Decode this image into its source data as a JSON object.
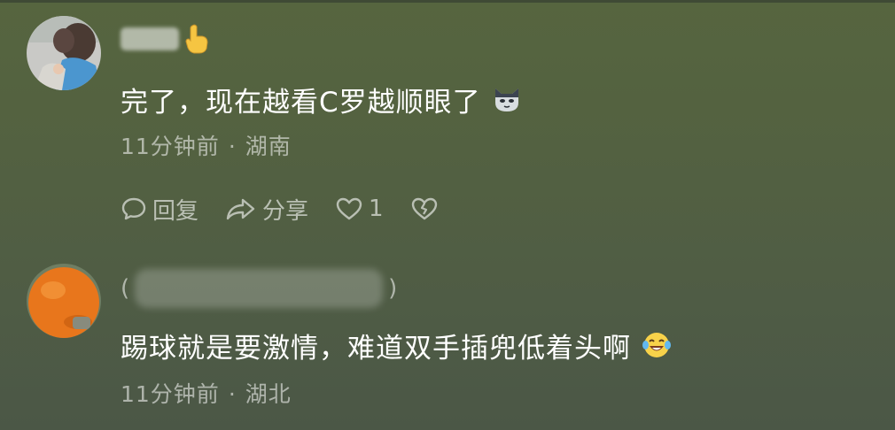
{
  "comments": [
    {
      "text": "完了，现在越看C罗越顺眼了",
      "time": "11分钟前",
      "separator": "·",
      "location": "湖南",
      "emoji_icon": "cat-emoji-icon",
      "actions": {
        "reply": "回复",
        "share": "分享",
        "like_count": "1"
      }
    },
    {
      "name_open_paren": "(",
      "name_close_paren": ")",
      "text": "踢球就是要激情，难道双手插兜低着头啊",
      "time": "11分钟前",
      "separator": "·",
      "location": "湖北",
      "emoji_icon": "laughing-tears-emoji-icon"
    }
  ],
  "colors": {
    "background": "#536141",
    "text_primary": "#ffffff",
    "text_secondary": "rgba(255,255,255,0.55)"
  }
}
